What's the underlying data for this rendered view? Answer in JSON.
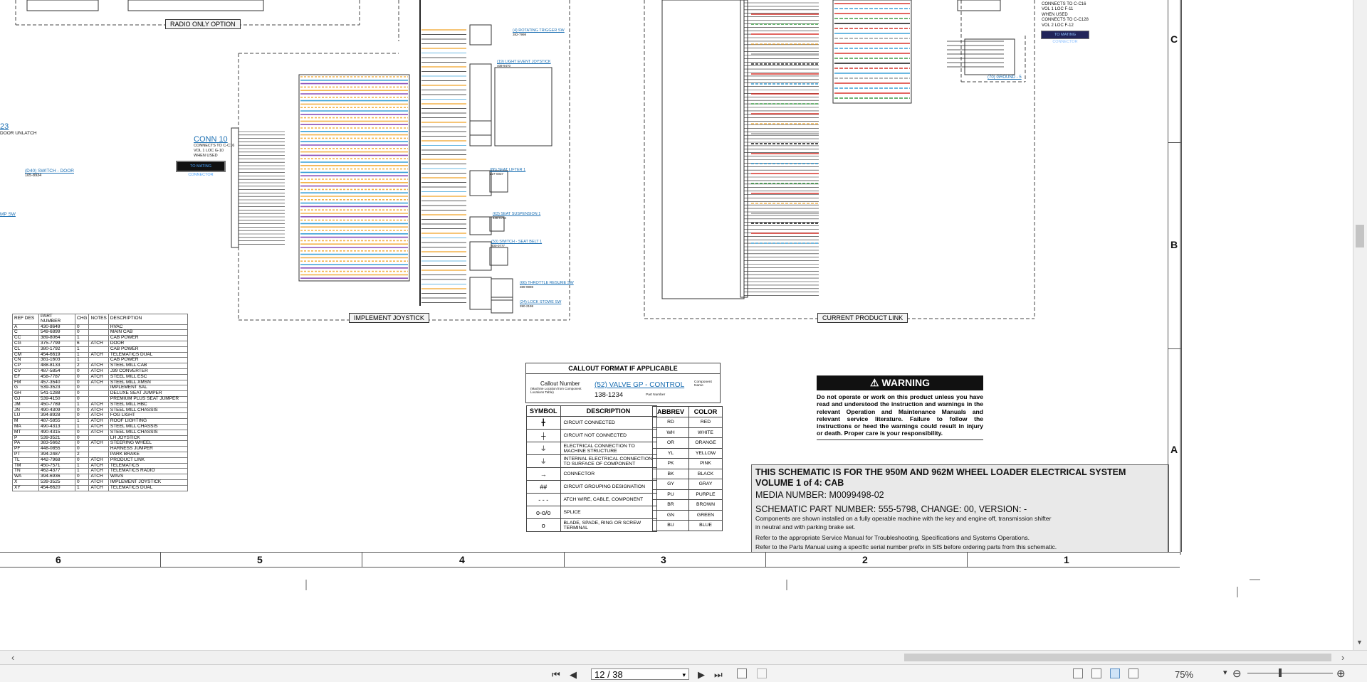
{
  "schematic": {
    "radio_only_option": "RADIO ONLY OPTION",
    "implement_joystick": "IMPLEMENT JOYSTICK",
    "current_product_link": "CURRENT PRODUCT LINK",
    "conn10": {
      "title": "CONN 10",
      "lines": [
        "CONNECTS TO C-C16",
        "VOL 1 LOC G-10",
        "WHEN USED"
      ],
      "mating": "TO MATING CONNECTOR"
    },
    "left_cut": {
      "num": "23",
      "label": "DOOR UNLATCH",
      "switch_link": "(D40) SWITCH - DOOR",
      "switch_part": "105-8934",
      "sw": "MP SW"
    },
    "conn_right": {
      "lines": [
        "CONNECTS TO C-C16",
        "VOL 1 LOC F-11",
        "WHEN USED",
        "CONNECTS TO C-C128",
        "VOL 2 LOC F-12"
      ],
      "mating": "TO MATING CONNECTOR",
      "ground": "(70) GROUND - 5"
    },
    "components": [
      {
        "label": "(4) ROTATING TRIGGER SW",
        "part": "382-7998"
      },
      {
        "label": "(19) LIGHT EVENT JOYSTICK",
        "part": "408-9470"
      },
      {
        "label": "(86) SEAT LIFTER 1",
        "part": "227-0037"
      },
      {
        "label": "(63) SEAT SUSPENSION 1",
        "part": "448-0764"
      },
      {
        "label": "(53) SWITCH - SEAT BELT 1",
        "part": "400-0777"
      },
      {
        "label": "(66) THROTTLE RESUME SW",
        "part": "389-9998"
      },
      {
        "label": "(24) LOCK STOWE SW",
        "part": "390-2198"
      }
    ]
  },
  "ref_table": {
    "headers": [
      "REF DES",
      "PART NUMBER",
      "CHG",
      "NOTES",
      "DESCRIPTION"
    ],
    "rows": [
      [
        "A",
        "430-8649",
        "0",
        "",
        "HVAC"
      ],
      [
        "C",
        "549-6899",
        "0",
        "",
        "MAIN CAB"
      ],
      [
        "CC",
        "389-8064",
        "1",
        "",
        "CAB POWER"
      ],
      [
        "CG",
        "375-7799",
        "6",
        "ATCH",
        "DOOR"
      ],
      [
        "CL",
        "380-1792",
        "1",
        "",
        "CAB POWER"
      ],
      [
        "CM",
        "454-6619",
        "1",
        "ATCH",
        "TELEMATICS DUAL"
      ],
      [
        "CN",
        "381-1603",
        "1",
        "",
        "CAB POWER"
      ],
      [
        "CP",
        "488-8133",
        "2",
        "ATCH",
        "STEEL MILL CAB"
      ],
      [
        "CV",
        "487-5854",
        "0",
        "ATCH",
        "J39 CONVERTER"
      ],
      [
        "EF",
        "458-7787",
        "0",
        "ATCH",
        "STEEL MILL ESC"
      ],
      [
        "FM",
        "457-3540",
        "0",
        "ATCH",
        "STEEL MILL XMSN"
      ],
      [
        "G",
        "539-3523",
        "0",
        "",
        "IMPLEMENT SAL"
      ],
      [
        "GH",
        "541-1288",
        "0",
        "",
        "DELUXE SEAT JUMPER"
      ],
      [
        "GJ",
        "539-4150",
        "0",
        "",
        "PREMIUM PLUS SEAT JUMPER"
      ],
      [
        "JM",
        "450-7789",
        "1",
        "ATCH",
        "STEEL MILL HBC"
      ],
      [
        "JN",
        "490-4309",
        "0",
        "ATCH",
        "STEEL MILL CHASSIS"
      ],
      [
        "LU",
        "394-8928",
        "0",
        "ATCH",
        "FOG LIGHT"
      ],
      [
        "M",
        "487-5855",
        "1",
        "ATCH",
        "ROOF LIGHTING"
      ],
      [
        "MA",
        "490-4313",
        "1",
        "ATCH",
        "STEEL MILL CHASSIS"
      ],
      [
        "MT",
        "490-4315",
        "0",
        "ATCH",
        "STEEL MILL CHASSIS"
      ],
      [
        "P",
        "539-3521",
        "0",
        "",
        "LH JOYSTICK"
      ],
      [
        "PA",
        "383-5662",
        "0",
        "ATCH",
        "STEERING WHEEL"
      ],
      [
        "PF",
        "448-0855",
        "0",
        "",
        "HARNESS JUMPER"
      ],
      [
        "PT",
        "394-2487",
        "2",
        "",
        "PARK BRAKE"
      ],
      [
        "TL",
        "442-7968",
        "0",
        "ATCH",
        "PRODUCT LINK"
      ],
      [
        "TM",
        "450-7571",
        "1",
        "ATCH",
        "TELEMATICS"
      ],
      [
        "TN",
        "462-4377",
        "1",
        "ATCH",
        "TELEMATICS RADIO"
      ],
      [
        "WA",
        "394-6936",
        "0",
        "ATCH",
        "WAVS"
      ],
      [
        "X",
        "539-3525",
        "0",
        "ATCH",
        "IMPLEMENT JOYSTICK"
      ],
      [
        "XY",
        "454-6620",
        "1",
        "ATCH",
        "TELEMATICS DUAL"
      ]
    ]
  },
  "callout": {
    "title": "CALLOUT FORMAT IF APPLICABLE",
    "callout_number_label": "Callout Number",
    "callout_sub": "(Machine Location from Component Locations Table)",
    "example_link": "(52) VALVE GP - CONTROL",
    "component_name": "Component Name",
    "example_part": "138-1234",
    "part_number_label": "Part Number"
  },
  "symbols": {
    "headers": [
      "SYMBOL",
      "DESCRIPTION"
    ],
    "rows": [
      {
        "sym": "╋",
        "desc": "CIRCUIT CONNECTED"
      },
      {
        "sym": "┼",
        "desc": "CIRCUIT NOT CONNECTED"
      },
      {
        "sym": "⏚",
        "desc": "ELECTRICAL CONNECTION TO MACHINE STRUCTURE"
      },
      {
        "sym": "⏚",
        "desc": "INTERNAL ELECTRICAL CONNECTION TO SURFACE OF COMPONENT"
      },
      {
        "sym": "→",
        "desc": "CONNECTOR"
      },
      {
        "sym": "##",
        "desc": "CIRCUIT GROUPING DESIGNATION"
      },
      {
        "sym": "- - -",
        "desc": "ATCH WIRE, CABLE, COMPONENT"
      },
      {
        "sym": "o-o/o",
        "desc": "SPLICE"
      },
      {
        "sym": "o",
        "desc": "BLADE, SPADE, RING OR SCREW TERMINAL"
      }
    ]
  },
  "colors": {
    "headers": [
      "ABBREV",
      "COLOR"
    ],
    "rows": [
      [
        "RD",
        "RED"
      ],
      [
        "WH",
        "WHITE"
      ],
      [
        "OR",
        "ORANGE"
      ],
      [
        "YL",
        "YELLOW"
      ],
      [
        "PK",
        "PINK"
      ],
      [
        "BK",
        "BLACK"
      ],
      [
        "GY",
        "GRAY"
      ],
      [
        "PU",
        "PURPLE"
      ],
      [
        "BR",
        "BROWN"
      ],
      [
        "GN",
        "GREEN"
      ],
      [
        "BU",
        "BLUE"
      ]
    ]
  },
  "warning": {
    "title": "WARNING",
    "body": "Do not operate or work on this product unless you have read and understood the instruction and warnings in the relevant Operation and Maintenance Manuals and relevant service literature. Failure to follow the instructions or heed the warnings could result in injury or death. Proper care is your responsibility."
  },
  "title_block": {
    "line1": "THIS SCHEMATIC IS FOR THE 950M AND 962M WHEEL LOADER ELECTRICAL SYSTEM",
    "line2": "VOLUME 1 of 4: CAB",
    "media": "MEDIA NUMBER: M0099498-02",
    "part": "SCHEMATIC PART NUMBER: 555-5798, CHANGE: 00, VERSION: -",
    "note1": "Components are shown installed on a fully operable machine with the key and engine off, transmission shifter",
    "note2": "in neutral and with parking brake set.",
    "note3": "Refer to the appropriate Service Manual for Troubleshooting, Specifications and Systems Operations.",
    "note4": "Refer to the Parts Manual using a specific serial number prefix in SIS before ordering parts from this schematic."
  },
  "ruler": {
    "columns": [
      "6",
      "5",
      "4",
      "3",
      "2",
      "1"
    ],
    "rows": [
      "C",
      "B",
      "A"
    ]
  },
  "status": {
    "page": "12 / 38",
    "zoom": "75%"
  },
  "wire_colors": {
    "orange": "#f3b24a",
    "blue": "#3aa0d8",
    "purple": "#8a4fb8",
    "red": "#d9342b",
    "green": "#3f9d48",
    "yellow": "#e3c923",
    "black": "#111111",
    "gray": "#9a9a9a"
  }
}
